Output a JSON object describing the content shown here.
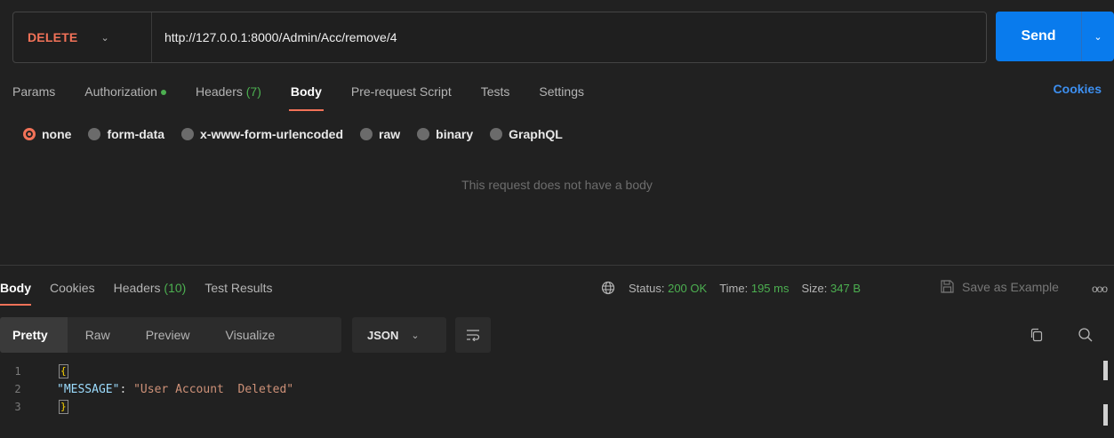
{
  "request": {
    "method": "DELETE",
    "url": "http://127.0.0.1:8000/Admin/Acc/remove/4",
    "send_label": "Send"
  },
  "request_tabs": [
    {
      "label": "Params"
    },
    {
      "label": "Authorization"
    },
    {
      "label": "Headers",
      "count": "(7)"
    },
    {
      "label": "Body"
    },
    {
      "label": "Pre-request Script"
    },
    {
      "label": "Tests"
    },
    {
      "label": "Settings"
    }
  ],
  "cookies_label": "Cookies",
  "body_types": [
    "none",
    "form-data",
    "x-www-form-urlencoded",
    "raw",
    "binary",
    "GraphQL"
  ],
  "no_body_text": "This request does not have a body",
  "response_tabs": [
    {
      "label": "Body"
    },
    {
      "label": "Cookies"
    },
    {
      "label": "Headers",
      "count": "(10)"
    },
    {
      "label": "Test Results"
    }
  ],
  "response_status": {
    "status_label": "Status:",
    "status_value": "200 OK",
    "time_label": "Time:",
    "time_value": "195 ms",
    "size_label": "Size:",
    "size_value": "347 B"
  },
  "save_example_label": "Save as Example",
  "more_label": "ooo",
  "format_tabs": [
    "Pretty",
    "Raw",
    "Preview",
    "Visualize"
  ],
  "format_select": "JSON",
  "code_lines": [
    {
      "n": "1",
      "text": "{"
    },
    {
      "n": "2",
      "key": "\"MESSAGE\"",
      "sep": ": ",
      "value": "\"User Account  Deleted\""
    },
    {
      "n": "3",
      "text": "}"
    }
  ],
  "colors": {
    "accent": "#f27258",
    "send": "#097bed",
    "success": "#4caf50",
    "link": "#3d8ff0"
  }
}
